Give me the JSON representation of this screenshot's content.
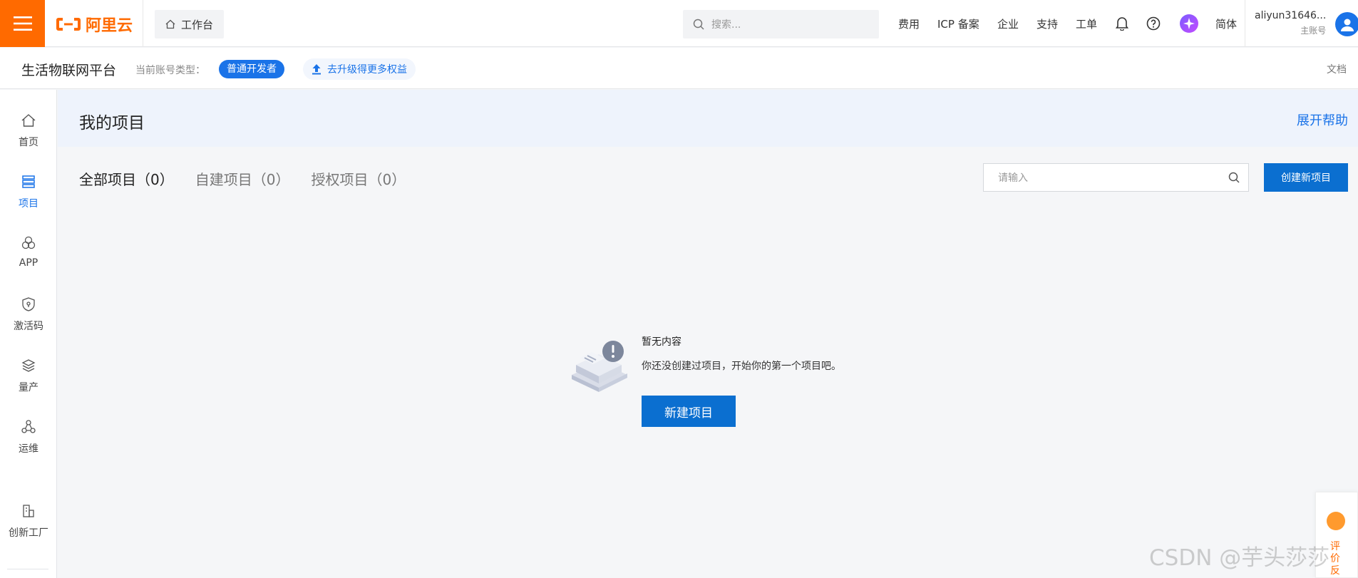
{
  "topbar": {
    "logo_text": "阿里云",
    "workbench_label": "工作台",
    "search_placeholder": "搜索...",
    "nav_items": [
      "费用",
      "ICP 备案",
      "企业",
      "支持",
      "工单"
    ],
    "lang_label": "简体",
    "username": "aliyun31646...",
    "account_type": "主账号"
  },
  "subbar": {
    "platform_title": "生活物联网平台",
    "account_type_label": "当前账号类型：",
    "developer_badge": "普通开发者",
    "upgrade_label": "去升级得更多权益",
    "docs_label": "文档"
  },
  "sidebar": {
    "items": [
      {
        "label": "首页",
        "icon": "home-icon"
      },
      {
        "label": "项目",
        "icon": "project-icon",
        "active": true
      },
      {
        "label": "APP",
        "icon": "app-icon"
      },
      {
        "label": "激活码",
        "icon": "shield-icon"
      },
      {
        "label": "量产",
        "icon": "layers-icon"
      },
      {
        "label": "运维",
        "icon": "ops-icon"
      },
      {
        "label": "创新工厂",
        "icon": "factory-icon"
      }
    ]
  },
  "main": {
    "page_title": "我的项目",
    "help_link": "展开帮助",
    "tabs": [
      "全部项目（0）",
      "自建项目（0）",
      "授权项目（0）"
    ],
    "search_placeholder": "请输入",
    "create_button": "创建新项目",
    "empty_title": "暂无内容",
    "empty_desc": "你还没创建过项目，开始你的第一个项目吧。",
    "new_project_button": "新建项目"
  },
  "feedback": {
    "label": "评价反"
  },
  "watermark": "CSDN @芋头莎莎",
  "colors": {
    "brand": "#ff6a00",
    "primary": "#0b6fd0",
    "link": "#1a73e8"
  }
}
